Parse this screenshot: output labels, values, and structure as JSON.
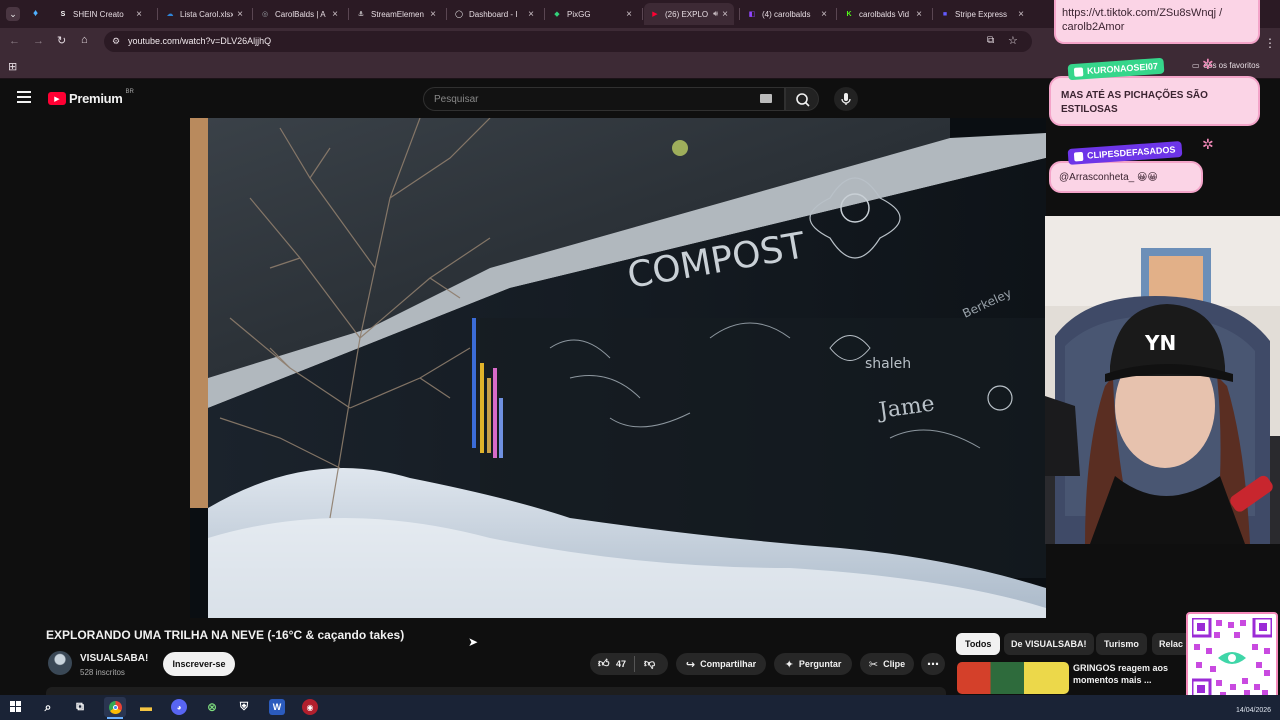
{
  "browser": {
    "tabs": [
      {
        "label": "SHEIN Creato",
        "color": "#ffffff",
        "glyph": "S"
      },
      {
        "label": "Lista Carol.xlsx",
        "color": "#2e84d8",
        "glyph": "☁"
      },
      {
        "label": "CarolBalds | A",
        "color": "#9aa0a6",
        "glyph": "◎"
      },
      {
        "label": "StreamElemen",
        "color": "#ffffff",
        "glyph": "⚓"
      },
      {
        "label": "Dashboard - I",
        "color": "#ffffff",
        "glyph": "◯"
      },
      {
        "label": "PixGG",
        "color": "#33d17a",
        "glyph": "◆"
      },
      {
        "label": "(26) EXPLO",
        "color": "#ff0033",
        "glyph": "▶"
      },
      {
        "label": "(4) carolbalds",
        "color": "#9146ff",
        "glyph": "◧"
      },
      {
        "label": "carolbalds Vid",
        "color": "#53fc18",
        "glyph": "K"
      },
      {
        "label": "Stripe Express",
        "color": "#635bff",
        "glyph": "■"
      }
    ],
    "url": "youtube.com/watch?v=DLV26AljjhQ",
    "bookmarks_label": "dos os favoritos"
  },
  "youtube": {
    "premium_label": "Premium",
    "premium_region": "BR",
    "search_placeholder": "Pesquisar",
    "video_title": "EXPLORANDO UMA TRILHA NA NEVE (-16°C & caçando takes)",
    "channel_name": "VISUALSABA!",
    "subscribers": "528 inscritos",
    "subscribe_label": "Inscrever-se",
    "likes": "47",
    "share_label": "Compartilhar",
    "ask_label": "Perguntar",
    "clip_label": "Clipe",
    "chips": [
      "Todos",
      "De VISUALSABA!",
      "Turismo",
      "Relac"
    ],
    "rec_title": "GRINGOS reagem aos momentos mais ...",
    "wall_text": "COMPOST"
  },
  "overlay": {
    "link_text": "https://vt.tiktok.com/ZSu8sWnqj / carolb2Amor",
    "chat": [
      {
        "user": "KURONAOSEI07",
        "message": "MAS ATÉ AS PICHAÇÕES SÃO ESTILOSAS"
      },
      {
        "user": "CLIPESDEFASADOS",
        "message": "@Arrasconheta_ 😀😀"
      }
    ],
    "cap_text": "YN"
  },
  "taskbar": {
    "date": "14/04/2026"
  }
}
